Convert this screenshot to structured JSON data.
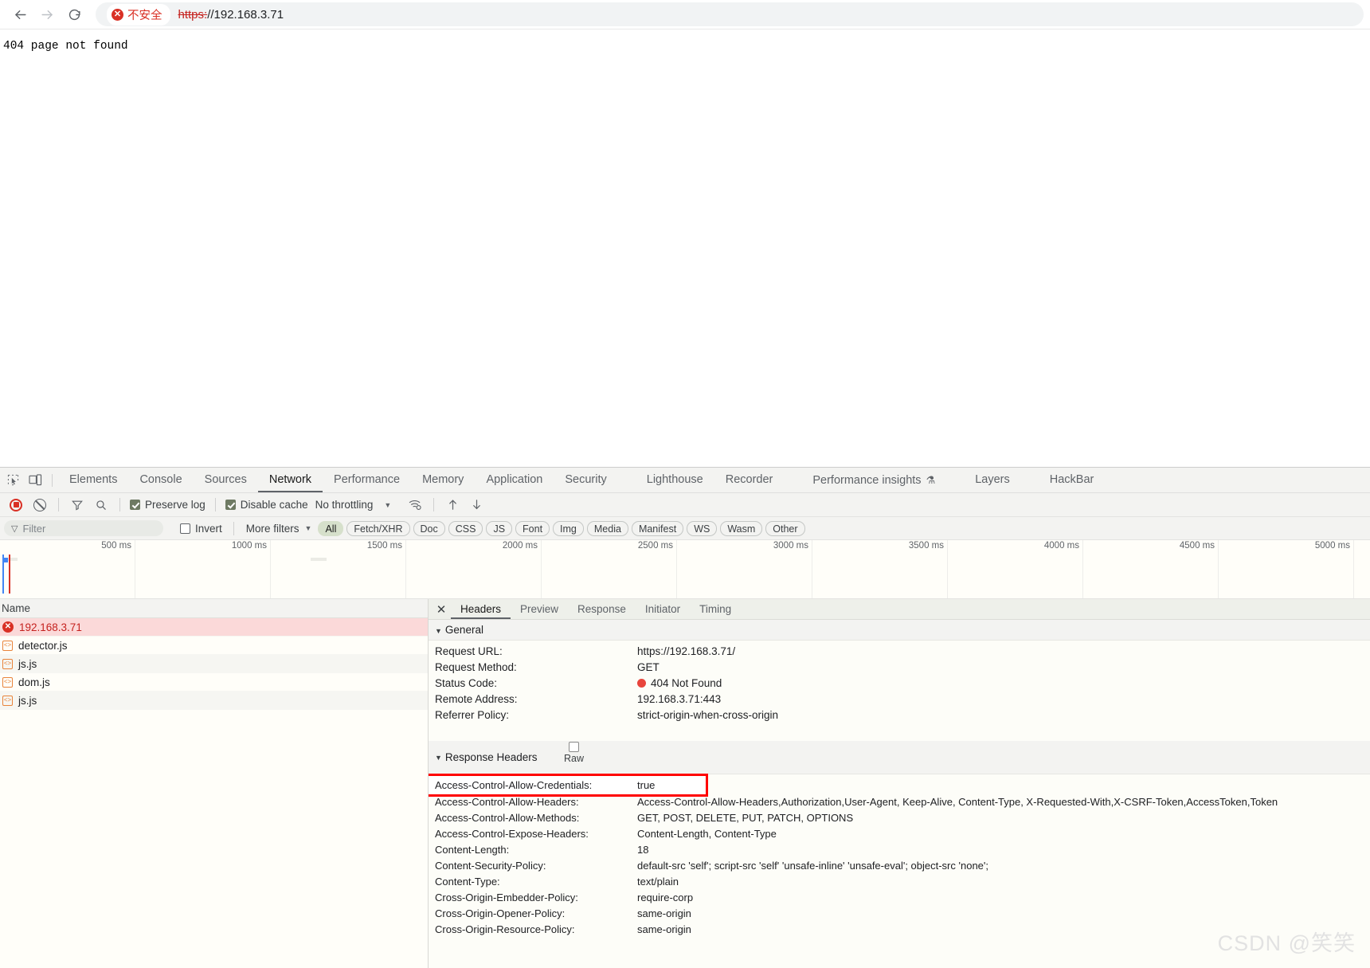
{
  "browser": {
    "back_icon": "arrow-left-icon",
    "forward_icon": "arrow-right-icon",
    "reload_icon": "reload-icon",
    "security_chip_label": "不安全",
    "url_scheme": "https:",
    "url_rest": "//192.168.3.71"
  },
  "page": {
    "body_text": "404 page not found"
  },
  "devtools": {
    "tabs": [
      {
        "label": "Elements",
        "active": false
      },
      {
        "label": "Console",
        "active": false
      },
      {
        "label": "Sources",
        "active": false
      },
      {
        "label": "Network",
        "active": true
      },
      {
        "label": "Performance",
        "active": false
      },
      {
        "label": "Memory",
        "active": false
      },
      {
        "label": "Application",
        "active": false
      },
      {
        "label": "Security",
        "active": false
      },
      {
        "label": "Lighthouse",
        "active": false
      },
      {
        "label": "Recorder",
        "active": false
      },
      {
        "label": "Performance insights",
        "active": false
      },
      {
        "label": "Layers",
        "active": false
      },
      {
        "label": "HackBar",
        "active": false
      }
    ],
    "toolbar": {
      "record_label": "record-button",
      "clear_label": "clear-button",
      "filter_icon": "funnel-icon",
      "search_icon": "search-icon",
      "preserve_log_label": "Preserve log",
      "preserve_log_checked": true,
      "disable_cache_label": "Disable cache",
      "disable_cache_checked": true,
      "throttling_value": "No throttling",
      "wifi_icon": "wifi-settings-icon",
      "import_icon": "import-har-icon",
      "export_icon": "export-har-icon"
    },
    "filter_bar": {
      "filter_placeholder": "Filter",
      "invert_label": "Invert",
      "invert_checked": false,
      "more_filters_label": "More filters",
      "types": [
        {
          "label": "All",
          "active": true
        },
        {
          "label": "Fetch/XHR",
          "active": false
        },
        {
          "label": "Doc",
          "active": false
        },
        {
          "label": "CSS",
          "active": false
        },
        {
          "label": "JS",
          "active": false
        },
        {
          "label": "Font",
          "active": false
        },
        {
          "label": "Img",
          "active": false
        },
        {
          "label": "Media",
          "active": false
        },
        {
          "label": "Manifest",
          "active": false
        },
        {
          "label": "WS",
          "active": false
        },
        {
          "label": "Wasm",
          "active": false
        },
        {
          "label": "Other",
          "active": false
        }
      ]
    },
    "overview": {
      "ticks": [
        "500 ms",
        "1000 ms",
        "1500 ms",
        "2000 ms",
        "2500 ms",
        "3000 ms",
        "3500 ms",
        "4000 ms",
        "4500 ms",
        "5000 ms"
      ]
    },
    "request_list": {
      "column_header": "Name",
      "rows": [
        {
          "name": "192.168.3.71",
          "icon": "error-icon",
          "selected": true
        },
        {
          "name": "detector.js",
          "icon": "js-file-icon",
          "selected": false
        },
        {
          "name": "js.js",
          "icon": "js-file-icon",
          "selected": false
        },
        {
          "name": "dom.js",
          "icon": "js-file-icon",
          "selected": false
        },
        {
          "name": "js.js",
          "icon": "js-file-icon",
          "selected": false
        }
      ]
    },
    "details": {
      "close_label": "✕",
      "tabs": [
        {
          "label": "Headers",
          "active": true
        },
        {
          "label": "Preview",
          "active": false
        },
        {
          "label": "Response",
          "active": false
        },
        {
          "label": "Initiator",
          "active": false
        },
        {
          "label": "Timing",
          "active": false
        }
      ],
      "general_title": "General",
      "general": [
        {
          "key": "Request URL:",
          "value": "https://192.168.3.71/"
        },
        {
          "key": "Request Method:",
          "value": "GET"
        },
        {
          "key": "Status Code:",
          "value": "404 Not Found",
          "status_dot": true
        },
        {
          "key": "Remote Address:",
          "value": "192.168.3.71:443"
        },
        {
          "key": "Referrer Policy:",
          "value": "strict-origin-when-cross-origin"
        }
      ],
      "response_headers_title": "Response Headers",
      "raw_label": "Raw",
      "raw_checked": false,
      "response_headers": [
        {
          "key": "Access-Control-Allow-Credentials:",
          "value": "true",
          "highlighted": true
        },
        {
          "key": "Access-Control-Allow-Headers:",
          "value": "Access-Control-Allow-Headers,Authorization,User-Agent, Keep-Alive, Content-Type, X-Requested-With,X-CSRF-Token,AccessToken,Token",
          "highlighted": false
        },
        {
          "key": "Access-Control-Allow-Methods:",
          "value": "GET, POST, DELETE, PUT, PATCH, OPTIONS",
          "highlighted": false
        },
        {
          "key": "Access-Control-Expose-Headers:",
          "value": "Content-Length, Content-Type",
          "highlighted": false
        },
        {
          "key": "Content-Length:",
          "value": "18",
          "highlighted": false
        },
        {
          "key": "Content-Security-Policy:",
          "value": "default-src 'self'; script-src 'self' 'unsafe-inline' 'unsafe-eval'; object-src 'none';",
          "highlighted": false
        },
        {
          "key": "Content-Type:",
          "value": "text/plain",
          "highlighted": false
        },
        {
          "key": "Cross-Origin-Embedder-Policy:",
          "value": "require-corp",
          "highlighted": false
        },
        {
          "key": "Cross-Origin-Opener-Policy:",
          "value": "same-origin",
          "highlighted": false
        },
        {
          "key": "Cross-Origin-Resource-Policy:",
          "value": "same-origin",
          "highlighted": false
        }
      ]
    }
  },
  "watermark": "CSDN @笑笑",
  "colors": {
    "accent_red": "#d93025",
    "highlight_red": "#ff0000",
    "selected_row_bg": "#fbd9d9",
    "active_chip_bg": "#d6e0cb"
  }
}
